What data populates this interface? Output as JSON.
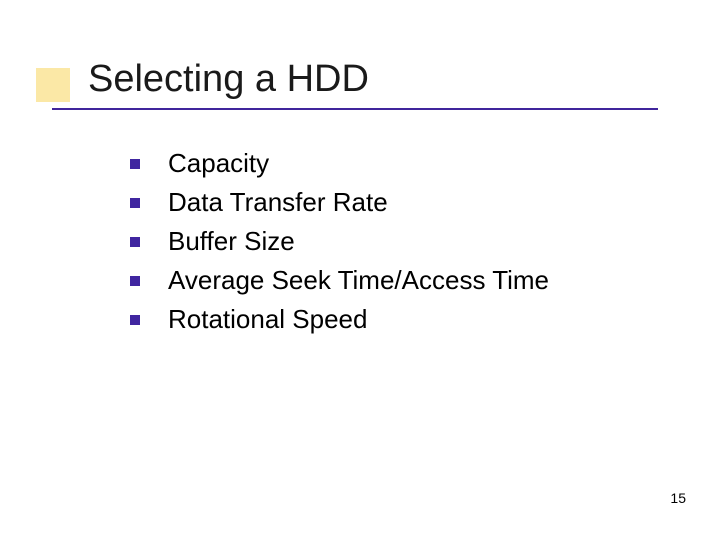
{
  "title": "Selecting a HDD",
  "bullets": [
    "Capacity",
    "Data Transfer Rate",
    "Buffer Size",
    "Average Seek Time/Access Time",
    "Rotational Speed"
  ],
  "page_number": "15"
}
